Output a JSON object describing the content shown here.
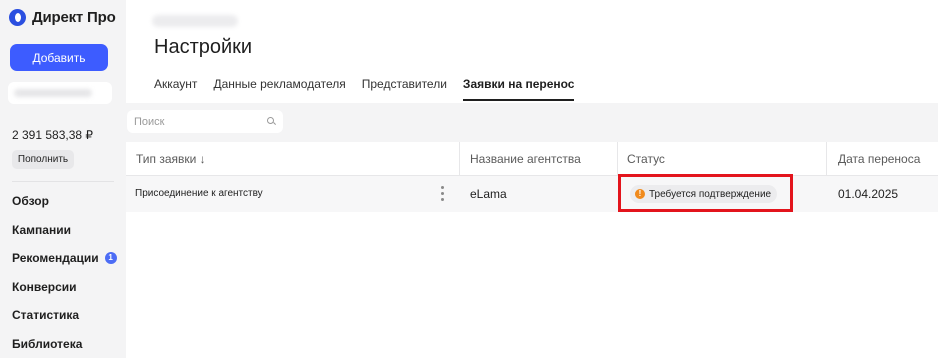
{
  "app": {
    "logo_text": "Директ Про"
  },
  "sidebar": {
    "add_label": "Добавить",
    "balance": "2 391 583,38 ₽",
    "topup_label": "Пополнить",
    "items": [
      {
        "label": "Обзор"
      },
      {
        "label": "Кампании"
      },
      {
        "label": "Рекомендации",
        "badge": "1"
      },
      {
        "label": "Конверсии"
      },
      {
        "label": "Статистика"
      },
      {
        "label": "Библиотека"
      }
    ]
  },
  "page": {
    "title": "Настройки"
  },
  "tabs": [
    {
      "label": "Аккаунт",
      "active": false
    },
    {
      "label": "Данные рекламодателя",
      "active": false
    },
    {
      "label": "Представители",
      "active": false
    },
    {
      "label": "Заявки на перенос",
      "active": true
    }
  ],
  "search": {
    "placeholder": "Поиск"
  },
  "table": {
    "columns": [
      "Тип заявки ↓",
      "Название агентства",
      "Статус",
      "Дата переноса"
    ],
    "rows": [
      {
        "type": "Присоединение к агентству",
        "agency": "eLama",
        "status": "Требуется подтверждение",
        "date": "01.04.2025"
      }
    ]
  },
  "colors": {
    "accent": "#3d5cff",
    "warning": "#f08a1c",
    "highlight": "#e3141c"
  },
  "icons": {
    "status": "warning-icon",
    "search": "search-icon",
    "row_menu": "more-vertical-icon"
  }
}
